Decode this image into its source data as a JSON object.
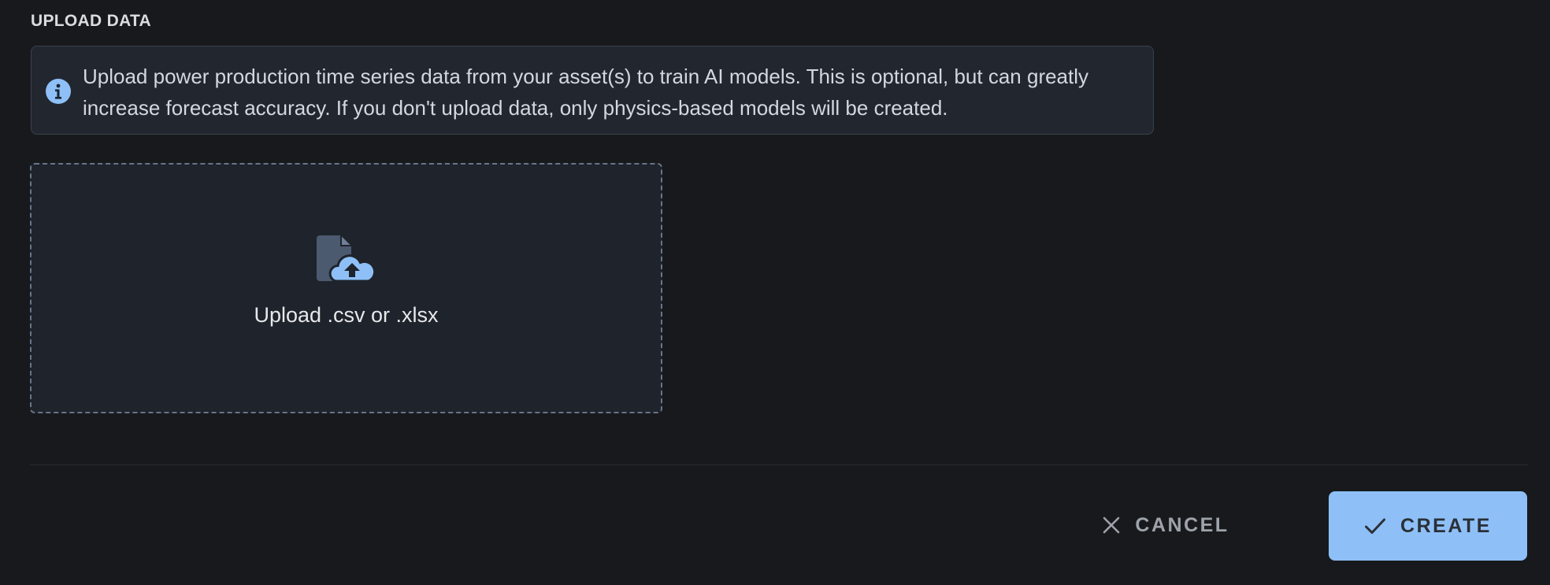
{
  "section": {
    "title": "UPLOAD DATA"
  },
  "info": {
    "icon": "info-icon",
    "text": "Upload power production time series data from your asset(s) to train AI models. This is optional, but can greatly increase forecast accuracy. If you don't upload data, only physics-based models will be created."
  },
  "dropzone": {
    "icon": "file-upload-icon",
    "label": "Upload .csv or .xlsx"
  },
  "actions": {
    "cancel": {
      "icon": "close-icon",
      "label": "CANCEL"
    },
    "create": {
      "icon": "check-icon",
      "label": "CREATE"
    }
  },
  "colors": {
    "background": "#18191c",
    "panel": "#22262e",
    "accent": "#8ec0f7",
    "dropzone_border": "#66768a"
  }
}
